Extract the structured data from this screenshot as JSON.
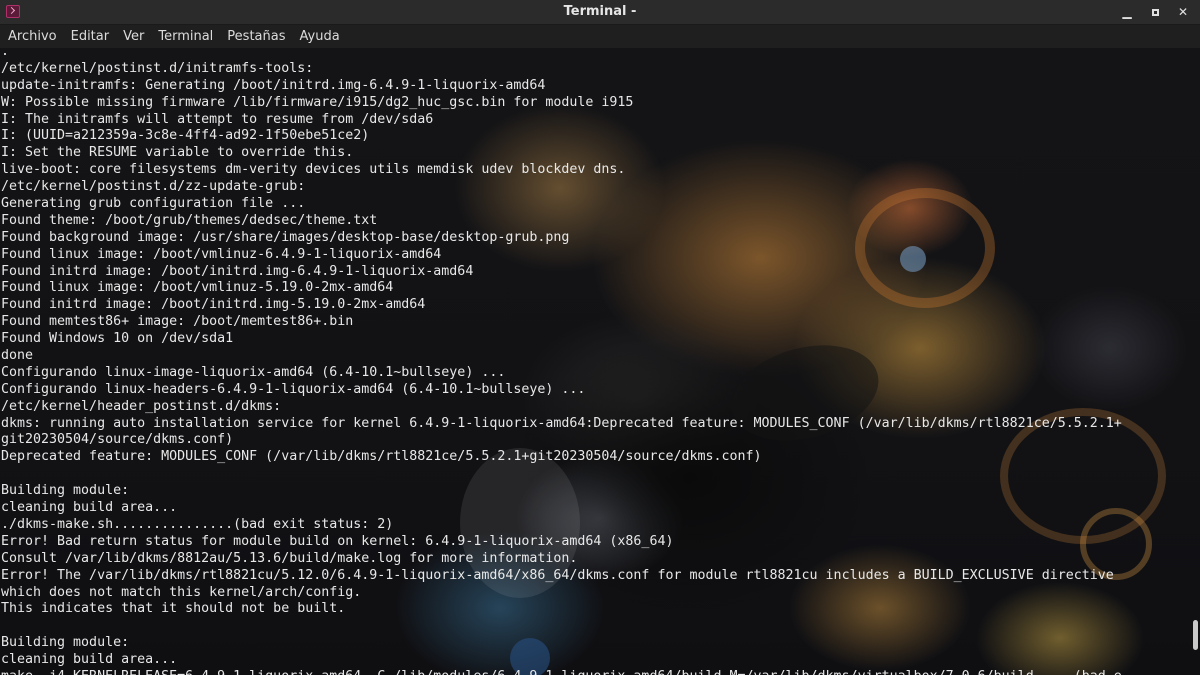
{
  "window": {
    "title": "Terminal -",
    "controls": {
      "minimize_glyph": "▁",
      "close_glyph": "✕"
    }
  },
  "menu": [
    "Archivo",
    "Editar",
    "Ver",
    "Terminal",
    "Pestañas",
    "Ayuda"
  ],
  "terminal": {
    "lines": [
      ".",
      "/etc/kernel/postinst.d/initramfs-tools:",
      "update-initramfs: Generating /boot/initrd.img-6.4.9-1-liquorix-amd64",
      "W: Possible missing firmware /lib/firmware/i915/dg2_huc_gsc.bin for module i915",
      "I: The initramfs will attempt to resume from /dev/sda6",
      "I: (UUID=a212359a-3c8e-4ff4-ad92-1f50ebe51ce2)",
      "I: Set the RESUME variable to override this.",
      "live-boot: core filesystems dm-verity devices utils memdisk udev blockdev dns.",
      "/etc/kernel/postinst.d/zz-update-grub:",
      "Generating grub configuration file ...",
      "Found theme: /boot/grub/themes/dedsec/theme.txt",
      "Found background image: /usr/share/images/desktop-base/desktop-grub.png",
      "Found linux image: /boot/vmlinuz-6.4.9-1-liquorix-amd64",
      "Found initrd image: /boot/initrd.img-6.4.9-1-liquorix-amd64",
      "Found linux image: /boot/vmlinuz-5.19.0-2mx-amd64",
      "Found initrd image: /boot/initrd.img-5.19.0-2mx-amd64",
      "Found memtest86+ image: /boot/memtest86+.bin",
      "Found Windows 10 on /dev/sda1",
      "done",
      "Configurando linux-image-liquorix-amd64 (6.4-10.1~bullseye) ...",
      "Configurando linux-headers-6.4.9-1-liquorix-amd64 (6.4-10.1~bullseye) ...",
      "/etc/kernel/header_postinst.d/dkms:",
      "dkms: running auto installation service for kernel 6.4.9-1-liquorix-amd64:Deprecated feature: MODULES_CONF (/var/lib/dkms/rtl8821ce/5.5.2.1+",
      "git20230504/source/dkms.conf)",
      "Deprecated feature: MODULES_CONF (/var/lib/dkms/rtl8821ce/5.5.2.1+git20230504/source/dkms.conf)",
      "",
      "Building module:",
      "cleaning build area...",
      "./dkms-make.sh...............(bad exit status: 2)",
      "Error! Bad return status for module build on kernel: 6.4.9-1-liquorix-amd64 (x86_64)",
      "Consult /var/lib/dkms/8812au/5.13.6/build/make.log for more information.",
      "Error! The /var/lib/dkms/rtl8821cu/5.12.0/6.4.9-1-liquorix-amd64/x86_64/dkms.conf for module rtl8821cu includes a BUILD_EXCLUSIVE directive",
      "which does not match this kernel/arch/config.",
      "This indicates that it should not be built.",
      "",
      "Building module:",
      "cleaning build area...",
      "make -j4 KERNELRELEASE=6.4.9-1-liquorix-amd64 -C /lib/modules/6.4.9-1-liquorix-amd64/build M=/var/lib/dkms/virtualbox/7.0.6/build.....(bad e"
    ]
  },
  "colors": {
    "titlebar": "#2b2b2b",
    "menubar": "#1f1f1f",
    "text": "#e8e8e8"
  }
}
